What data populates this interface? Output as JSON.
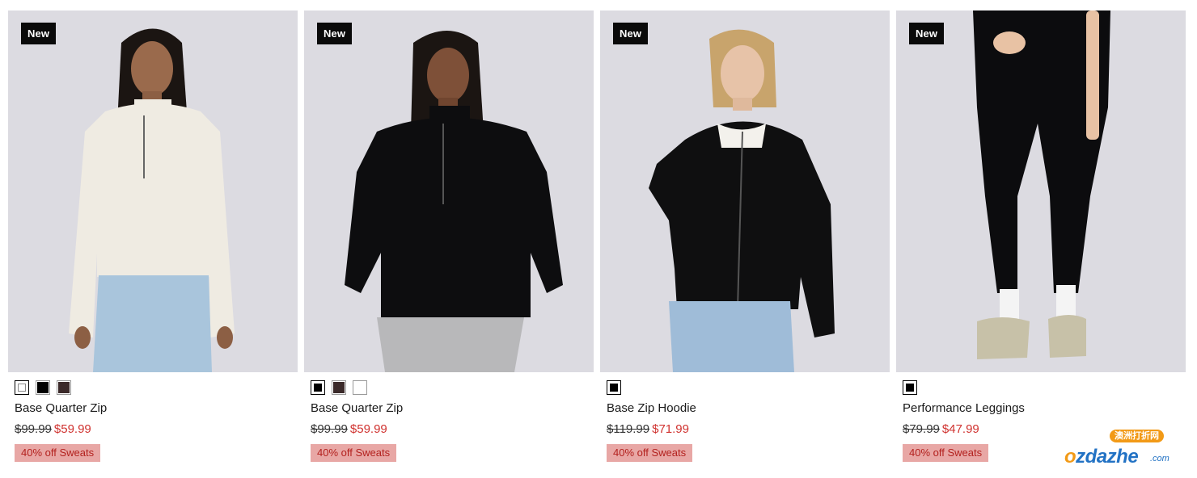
{
  "products": [
    {
      "badge": "New",
      "image_alt": "model-cream-quarter-zip",
      "swatches": [
        "#ffffff",
        "#000000",
        "#3b2a2a"
      ],
      "selected_swatch": 0,
      "name": "Base Quarter Zip",
      "old_price": "$99.99",
      "new_price": "$59.99",
      "promo": "40% off Sweats"
    },
    {
      "badge": "New",
      "image_alt": "model-black-quarter-zip",
      "swatches": [
        "#000000",
        "#3b2a2a",
        "#ffffff"
      ],
      "selected_swatch": 0,
      "name": "Base Quarter Zip",
      "old_price": "$99.99",
      "new_price": "$59.99",
      "promo": "40% off Sweats"
    },
    {
      "badge": "New",
      "image_alt": "model-black-zip-hoodie",
      "swatches": [
        "#000000"
      ],
      "selected_swatch": 0,
      "name": "Base Zip Hoodie",
      "old_price": "$119.99",
      "new_price": "$71.99",
      "promo": "40% off Sweats"
    },
    {
      "badge": "New",
      "image_alt": "model-black-leggings",
      "swatches": [
        "#000000"
      ],
      "selected_swatch": 0,
      "name": "Performance Leggings",
      "old_price": "$79.99",
      "new_price": "$47.99",
      "promo": "40% off Sweats"
    }
  ],
  "watermark": {
    "tag": "澳洲打折网",
    "brand_o": "o",
    "brand_rest": "zdazhe",
    "suffix": ".com"
  },
  "colors": {
    "badge_bg": "#0a0a0a",
    "sale_price": "#d0322f",
    "promo_bg": "#e8a7a5",
    "promo_text": "#b3211e",
    "image_bg": "#dcdbe1"
  }
}
